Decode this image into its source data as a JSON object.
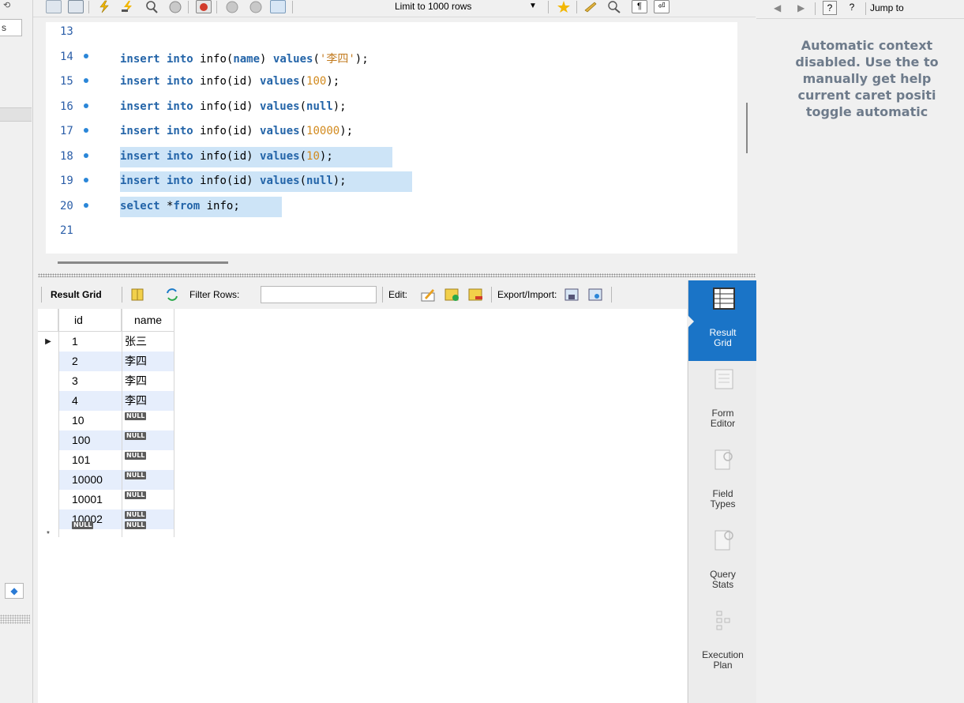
{
  "toolbar": {
    "limit_label": "Limit to 1000 rows"
  },
  "editor": {
    "lines": [
      {
        "num": "13",
        "marker": false,
        "selected": false,
        "tokens": []
      },
      {
        "num": "14",
        "marker": true,
        "selected": false,
        "tokens": [
          {
            "t": "insert into ",
            "c": "kw"
          },
          {
            "t": "info(",
            "c": ""
          },
          {
            "t": "name",
            "c": "kw"
          },
          {
            "t": ") ",
            "c": ""
          },
          {
            "t": "values",
            "c": "kw"
          },
          {
            "t": "(",
            "c": ""
          },
          {
            "t": "'李四'",
            "c": "str"
          },
          {
            "t": ");",
            "c": ""
          }
        ]
      },
      {
        "num": "15",
        "marker": true,
        "selected": false,
        "tokens": [
          {
            "t": "insert into ",
            "c": "kw"
          },
          {
            "t": "info(id) ",
            "c": ""
          },
          {
            "t": "values",
            "c": "kw"
          },
          {
            "t": "(",
            "c": ""
          },
          {
            "t": "100",
            "c": "num"
          },
          {
            "t": ");",
            "c": ""
          }
        ]
      },
      {
        "num": "16",
        "marker": true,
        "selected": false,
        "tokens": [
          {
            "t": "insert into ",
            "c": "kw"
          },
          {
            "t": "info(id) ",
            "c": ""
          },
          {
            "t": "values",
            "c": "kw"
          },
          {
            "t": "(",
            "c": ""
          },
          {
            "t": "null",
            "c": "kw"
          },
          {
            "t": ");",
            "c": ""
          }
        ]
      },
      {
        "num": "17",
        "marker": true,
        "selected": false,
        "tokens": [
          {
            "t": "insert into ",
            "c": "kw"
          },
          {
            "t": "info(id) ",
            "c": ""
          },
          {
            "t": "values",
            "c": "kw"
          },
          {
            "t": "(",
            "c": ""
          },
          {
            "t": "10000",
            "c": "num"
          },
          {
            "t": ");",
            "c": ""
          }
        ]
      },
      {
        "num": "18",
        "marker": true,
        "selected": true,
        "tokens": [
          {
            "t": "insert into ",
            "c": "kw"
          },
          {
            "t": "info(id) ",
            "c": ""
          },
          {
            "t": "values",
            "c": "kw"
          },
          {
            "t": "(",
            "c": ""
          },
          {
            "t": "10",
            "c": "num"
          },
          {
            "t": ");",
            "c": ""
          }
        ]
      },
      {
        "num": "19",
        "marker": true,
        "selected": true,
        "tokens": [
          {
            "t": "insert into ",
            "c": "kw"
          },
          {
            "t": "info(id) ",
            "c": ""
          },
          {
            "t": "values",
            "c": "kw"
          },
          {
            "t": "(",
            "c": ""
          },
          {
            "t": "null",
            "c": "kw"
          },
          {
            "t": ");",
            "c": ""
          }
        ]
      },
      {
        "num": "20",
        "marker": true,
        "selected": true,
        "tokens": [
          {
            "t": "select ",
            "c": "kw"
          },
          {
            "t": "*",
            "c": ""
          },
          {
            "t": "from ",
            "c": "kw"
          },
          {
            "t": "info;",
            "c": ""
          }
        ]
      },
      {
        "num": "21",
        "marker": false,
        "selected": false,
        "tokens": []
      }
    ]
  },
  "result_toolbar": {
    "result_grid_label": "Result Grid",
    "filter_rows_label": "Filter Rows:",
    "edit_label": "Edit:",
    "export_label": "Export/Import:"
  },
  "grid": {
    "columns": [
      "id",
      "name"
    ],
    "null_text": "NULL",
    "rows": [
      {
        "id": "1",
        "name": "张三"
      },
      {
        "id": "2",
        "name": "李四"
      },
      {
        "id": "3",
        "name": "李四"
      },
      {
        "id": "4",
        "name": "李四"
      },
      {
        "id": "10",
        "name": null
      },
      {
        "id": "100",
        "name": null
      },
      {
        "id": "101",
        "name": null
      },
      {
        "id": "10000",
        "name": null
      },
      {
        "id": "10001",
        "name": null
      },
      {
        "id": "10002",
        "name": null
      }
    ],
    "new_row_marker": "*",
    "current_row_marker": "▶"
  },
  "side_panel": {
    "items": [
      {
        "label1": "Result",
        "label2": "Grid",
        "active": true
      },
      {
        "label1": "Form",
        "label2": "Editor",
        "active": false
      },
      {
        "label1": "Field",
        "label2": "Types",
        "active": false
      },
      {
        "label1": "Query",
        "label2": "Stats",
        "active": false
      },
      {
        "label1": "Execution",
        "label2": "Plan",
        "active": false
      }
    ]
  },
  "right_panel": {
    "jump_label": "Jump to",
    "help_lines": [
      "Automatic context",
      "disabled. Use the to",
      "manually get help",
      "current caret positi",
      "toggle automatic"
    ]
  },
  "left_panel": {
    "filter_text": "s"
  }
}
